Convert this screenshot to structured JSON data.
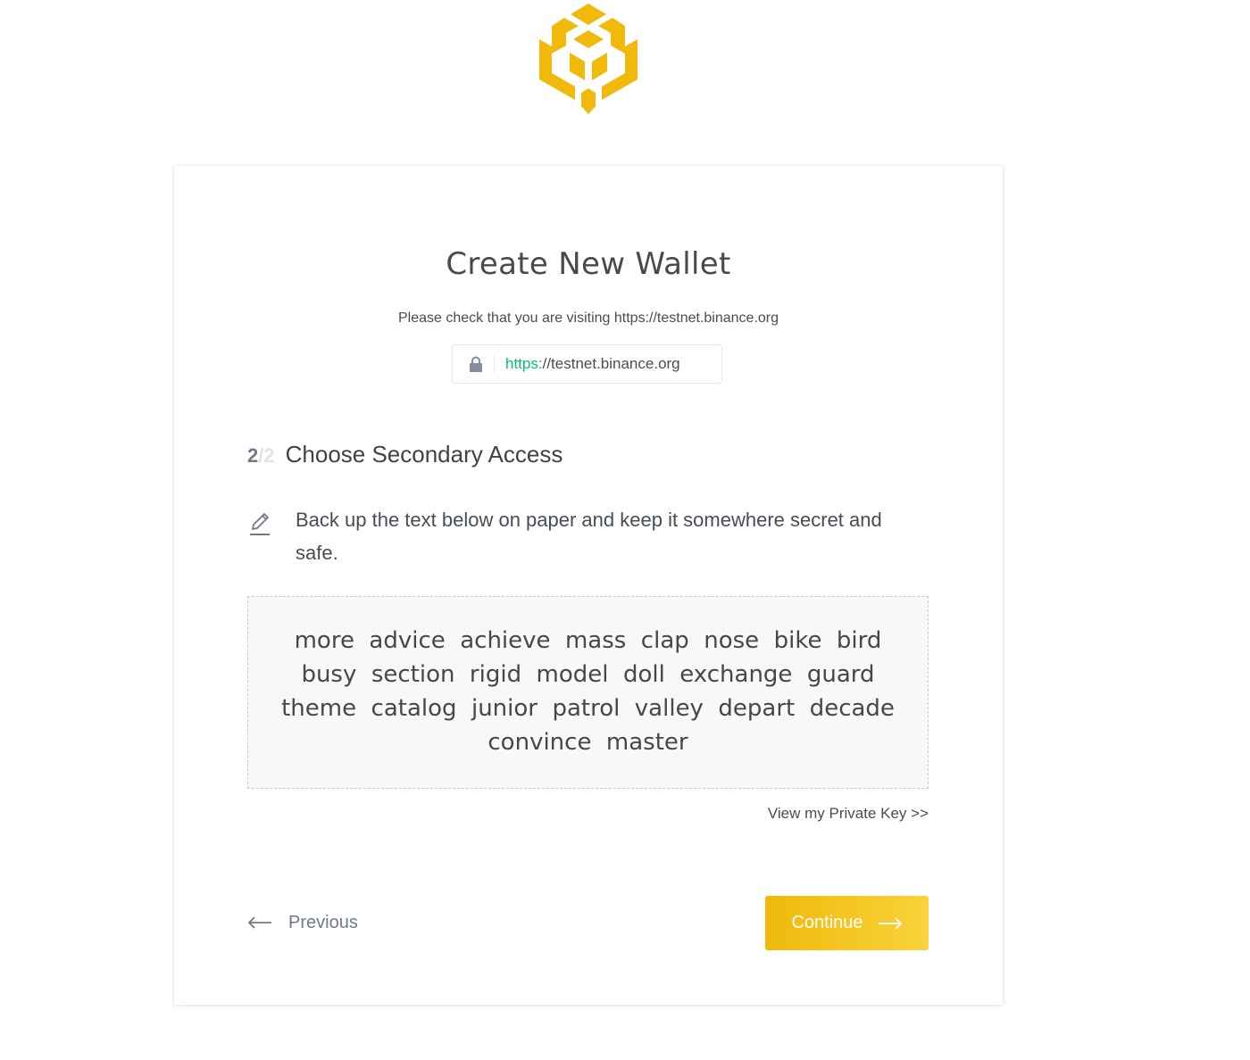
{
  "brand": {
    "logo_icon": "binance-chain-cube-logo-icon",
    "color": "#f0b90b"
  },
  "card": {
    "title": "Create New Wallet",
    "check_text": "Please check that you are visiting https://testnet.binance.org",
    "url": {
      "lock_icon": "lock-icon",
      "scheme": "https:",
      "rest": "//testnet.binance.org",
      "scheme_color": "#02c076"
    },
    "step": {
      "current": "2",
      "separator": "/",
      "total": "2",
      "title": "Choose Secondary Access"
    },
    "instruction": {
      "icon": "pencil-icon",
      "text": "Back up the text below on paper and keep it somewhere secret and safe."
    },
    "mnemonic": [
      "more",
      "advice",
      "achieve",
      "mass",
      "clap",
      "nose",
      "bike",
      "bird",
      "busy",
      "section",
      "rigid",
      "model",
      "doll",
      "exchange",
      "guard",
      "theme",
      "catalog",
      "junior",
      "patrol",
      "valley",
      "depart",
      "decade",
      "convince",
      "master"
    ],
    "private_key_link": "View my Private Key >>",
    "previous_label": "Previous",
    "continue_label": "Continue"
  }
}
